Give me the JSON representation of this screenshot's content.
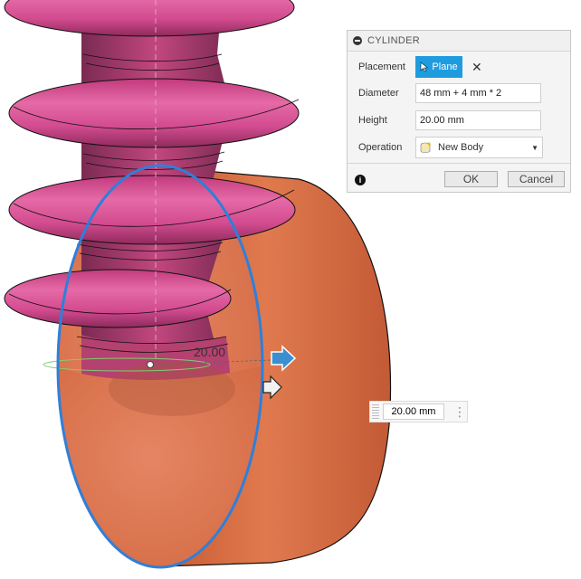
{
  "viewport": {
    "dimension_label": "20.00",
    "height_box": {
      "value": "20.00 mm",
      "menu_icon": "more-vertical-icon"
    }
  },
  "dialog": {
    "title": "CYLINDER",
    "placement": {
      "label": "Placement",
      "button": "Plane"
    },
    "diameter": {
      "label": "Diameter",
      "value": "48 mm + 4 mm * 2"
    },
    "height": {
      "label": "Height",
      "value": "20.00 mm"
    },
    "operation": {
      "label": "Operation",
      "value": "New Body"
    },
    "ok": "OK",
    "cancel": "Cancel"
  },
  "colors": {
    "cylinder": "#d9704a",
    "coil": "#d64a8c",
    "profile_circle": "#2f7fd9",
    "accent": "#1f9ce0"
  }
}
